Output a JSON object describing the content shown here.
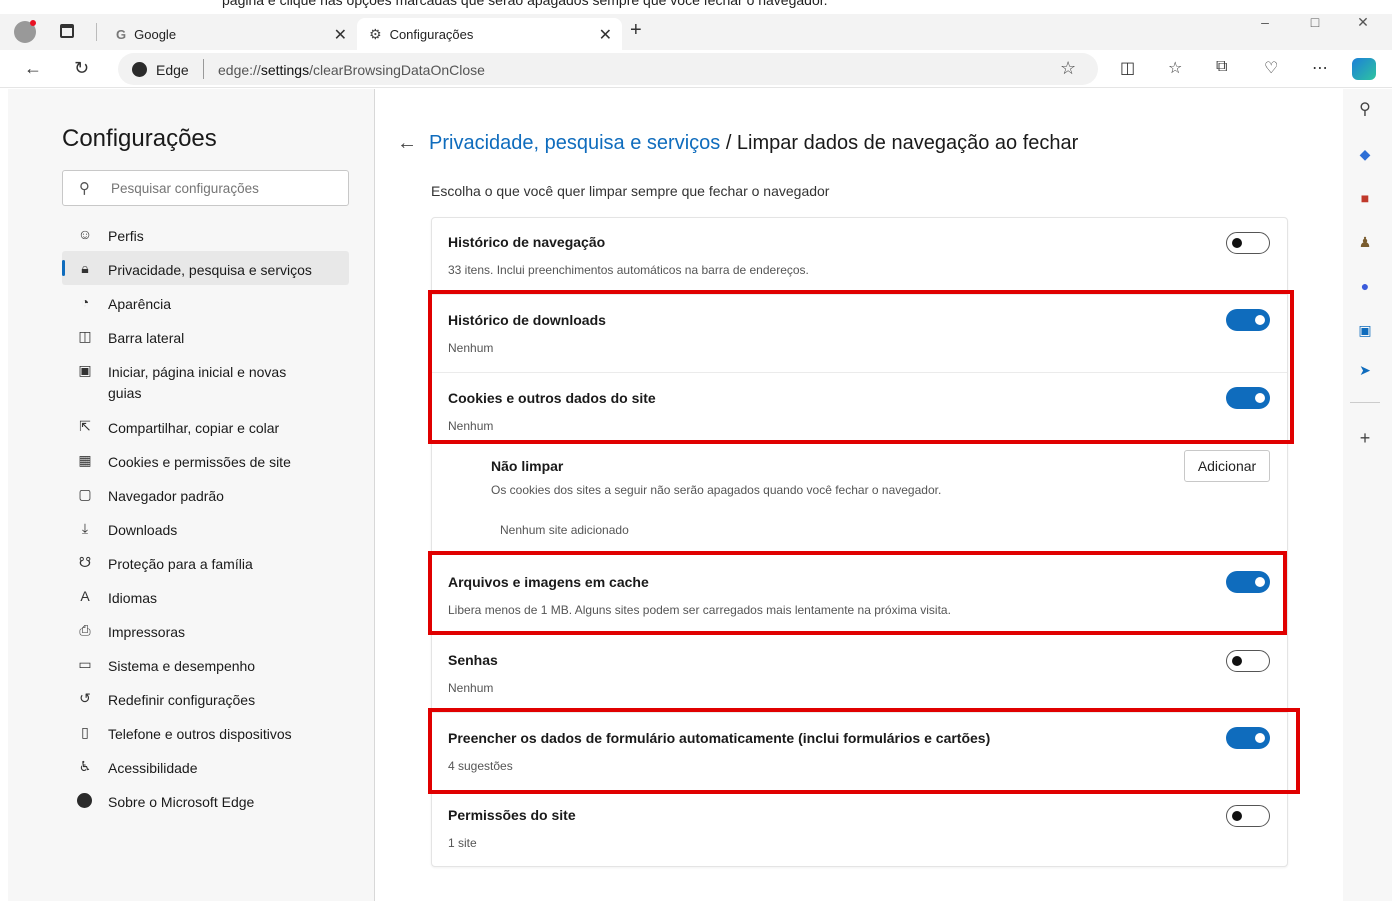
{
  "top_strip_text": "página e clique nas opções marcadas que serão apagados sempre que você fechar o navegador.",
  "browser": {
    "tabs": [
      {
        "title": "Google",
        "icon": "google-icon"
      },
      {
        "title": "Configurações",
        "icon": "gear-icon"
      }
    ],
    "new_tab": "+",
    "window_controls": [
      "–",
      "□",
      "✕"
    ]
  },
  "address_bar": {
    "site_label": "Edge",
    "url_prefix": "edge://",
    "url_host": "settings",
    "url_path": "/clearBrowsingDataOnClose"
  },
  "sidebar": {
    "title": "Configurações",
    "search_placeholder": "Pesquisar configurações",
    "items": [
      {
        "label": "Perfis",
        "icon": "profile-icon"
      },
      {
        "label": "Privacidade, pesquisa e serviços",
        "icon": "lock-icon",
        "active": true
      },
      {
        "label": "Aparência",
        "icon": "palette-icon"
      },
      {
        "label": "Barra lateral",
        "icon": "sidebar-icon"
      },
      {
        "label": "Iniciar, página inicial e novas",
        "label2": "guias",
        "icon": "home-icon"
      },
      {
        "label": "Compartilhar, copiar e colar",
        "icon": "share-icon"
      },
      {
        "label": "Cookies e permissões de site",
        "icon": "cookie-icon"
      },
      {
        "label": "Navegador padrão",
        "icon": "browser-icon"
      },
      {
        "label": "Downloads",
        "icon": "download-icon"
      },
      {
        "label": "Proteção para a família",
        "icon": "family-icon"
      },
      {
        "label": "Idiomas",
        "icon": "language-icon"
      },
      {
        "label": "Impressoras",
        "icon": "printer-icon"
      },
      {
        "label": "Sistema e desempenho",
        "icon": "laptop-icon"
      },
      {
        "label": "Redefinir configurações",
        "icon": "reset-icon"
      },
      {
        "label": "Telefone e outros dispositivos",
        "icon": "phone-icon"
      },
      {
        "label": "Acessibilidade",
        "icon": "accessibility-icon"
      },
      {
        "label": "Sobre o Microsoft Edge",
        "icon": "edge-logo-icon"
      }
    ]
  },
  "main": {
    "breadcrumb_link": "Privacidade, pesquisa e serviços",
    "breadcrumb_rest": " / Limpar dados de navegação ao fechar",
    "subtitle": "Escolha o que você quer limpar sempre que fechar o navegador",
    "settings": [
      {
        "title": "Histórico de navegação",
        "desc": "33 itens. Inclui preenchimentos automáticos na barra de endereços.",
        "on": false
      },
      {
        "title": "Histórico de downloads",
        "desc": "Nenhum",
        "on": true
      },
      {
        "title": "Cookies e outros dados do site",
        "desc": "Nenhum",
        "on": true
      },
      {
        "title": "Arquivos e imagens em cache",
        "desc": "Libera menos de 1 MB. Alguns sites podem ser carregados mais lentamente na próxima visita.",
        "on": true
      },
      {
        "title": "Senhas",
        "desc": "Nenhum",
        "on": false
      },
      {
        "title": "Preencher os dados de formulário automaticamente (inclui formulários e cartões)",
        "desc": "4 sugestões",
        "on": true
      },
      {
        "title": "Permissões do site",
        "desc": "1 site",
        "on": false
      }
    ],
    "dont_clear": {
      "title": "Não limpar",
      "desc": "Os cookies dos sites a seguir não serão apagados quando você fechar o navegador.",
      "empty": "Nenhum site adicionado",
      "button": "Adicionar"
    }
  },
  "colors": {
    "accent": "#0f6cbd",
    "highlight": "#e00000"
  }
}
